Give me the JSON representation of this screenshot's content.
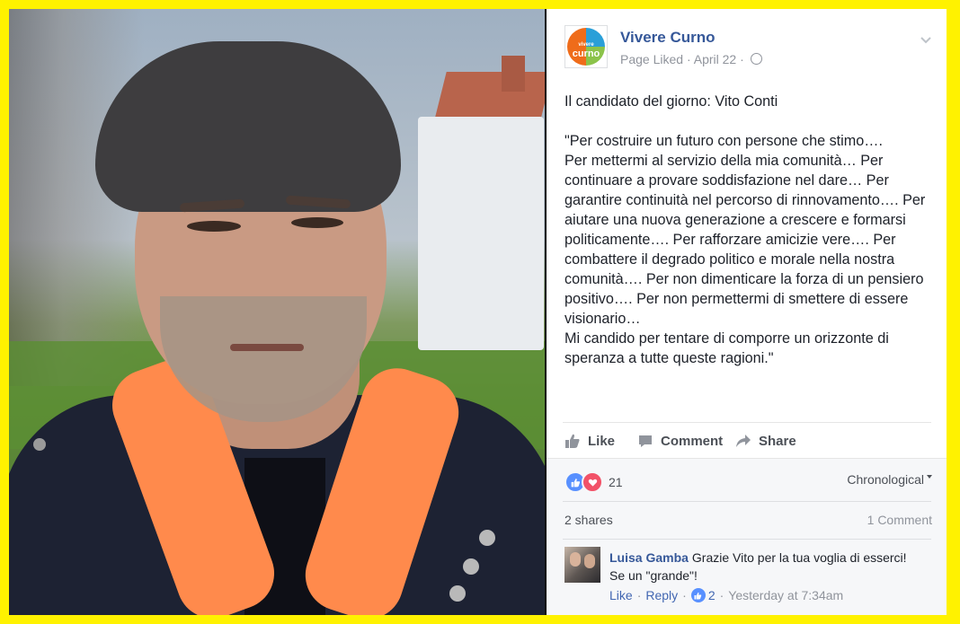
{
  "post": {
    "page_name": "Vivere Curno",
    "avatar_text_top": "vivere",
    "avatar_text_bottom": "curno",
    "status": "Page Liked",
    "separator": "·",
    "date": "April 22",
    "body": "Il candidato del giorno: Vito Conti\n\n\"Per costruire un futuro con persone che stimo….\nPer mettermi al servizio della mia comunità… Per continuare a provare soddisfazione nel dare… Per garantire continuità nel percorso di rinnovamento…. Per aiutare una nuova generazione a crescere e formarsi politicamente…. Per rafforzare amicizie vere…. Per combattere il degrado politico e morale nella nostra comunità…. Per non dimenticare la forza di un pensiero positivo…. Per non permettermi di smettere di essere visionario…\nMi candido per tentare di comporre un orizzonte di speranza a tutte queste ragioni.\""
  },
  "actions": {
    "like": "Like",
    "comment": "Comment",
    "share": "Share"
  },
  "stats": {
    "reaction_count": "21",
    "sort": "Chronological",
    "shares": "2 shares",
    "comments": "1 Comment"
  },
  "comment": {
    "author": "Luisa Gamba",
    "text": "Grazie Vito per la tua voglia di esserci! Se un \"grande\"!",
    "like": "Like",
    "reply": "Reply",
    "likes": "2",
    "time": "Yesterday at 7:34am",
    "dot": "·"
  },
  "icons": {
    "globe": "globe-icon",
    "chevron": "chevron-down-icon",
    "like": "thumbs-up-icon",
    "comment": "comment-bubble-icon",
    "share": "share-arrow-icon",
    "love": "heart-icon"
  },
  "colors": {
    "frame": "#fff200",
    "link": "#365899",
    "like_blue": "#5890ff",
    "love_red": "#f25268",
    "scarf": "#ff8a4c"
  }
}
